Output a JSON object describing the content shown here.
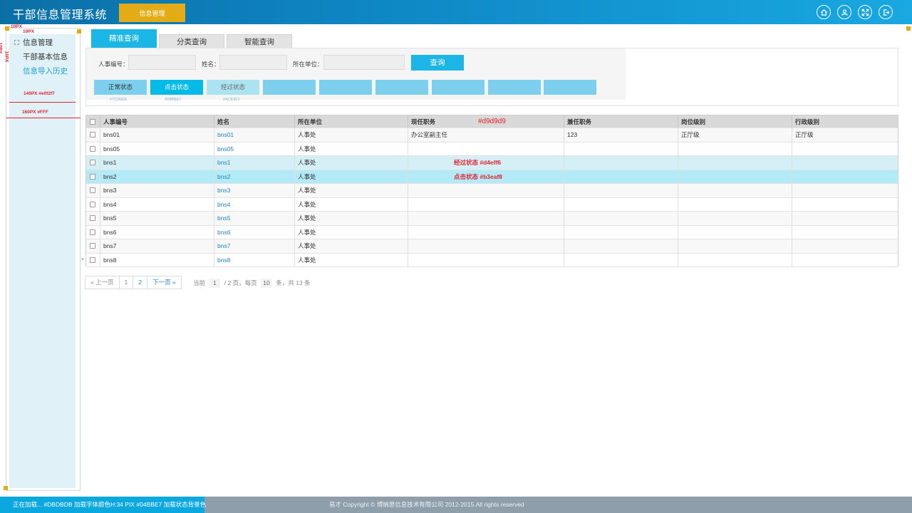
{
  "header": {
    "title": "干部信息管理系统",
    "nav_tab": "信息管理",
    "icons": [
      "home-icon",
      "user-icon",
      "fullscreen-icon",
      "logout-icon"
    ]
  },
  "sidebar": {
    "items": [
      {
        "label": "信息管理",
        "state": "active"
      },
      {
        "label": "干部基本信息",
        "state": "normal"
      },
      {
        "label": "信息导入历史",
        "state": "link"
      }
    ],
    "annotations": {
      "margin_top": "10PX",
      "margin_left": "10PX",
      "inner_size": "140PX  #e0f2f7",
      "outer_size": "160PX  #FFF"
    }
  },
  "tabs": [
    {
      "label": "精准查询",
      "active": true
    },
    {
      "label": "分类查询",
      "active": false
    },
    {
      "label": "智能查询",
      "active": false
    }
  ],
  "search": {
    "field_personnel_no": "人事编号：",
    "field_name": "姓名：",
    "field_unit": "所在单位：",
    "query_button": "查询"
  },
  "state_buttons": [
    {
      "label": "正常状态",
      "caption": "#7CD0EE",
      "color": "#7cd0ee"
    },
    {
      "label": "点击状态",
      "caption": "#04BBE7",
      "color": "#04bbe7"
    },
    {
      "label": "经过状态",
      "caption": "#ACE3F1",
      "color": "#ace3f1"
    },
    {
      "label": "",
      "caption": "",
      "color": "#7cd0ee"
    },
    {
      "label": "",
      "caption": "",
      "color": "#7cd0ee"
    },
    {
      "label": "",
      "caption": "",
      "color": "#7cd0ee"
    },
    {
      "label": "",
      "caption": "",
      "color": "#7cd0ee"
    },
    {
      "label": "",
      "caption": "",
      "color": "#7cd0ee"
    },
    {
      "label": "",
      "caption": "",
      "color": "#7cd0ee"
    }
  ],
  "table": {
    "header_annotation": "#d9d9d9",
    "columns": [
      "人事编号",
      "姓名",
      "所在单位",
      "现任职务",
      "兼任职务",
      "岗位级别",
      "行政级别"
    ],
    "rows": [
      {
        "id": "bns01",
        "name": "bns01",
        "unit": "人事处",
        "duty": "办公室副主任",
        "part_time": "123",
        "post_level": "正厅级",
        "admin_level": "正厅级",
        "state": "normal",
        "note": ""
      },
      {
        "id": "bns05",
        "name": "bns05",
        "unit": "人事处",
        "duty": "",
        "part_time": "",
        "post_level": "",
        "admin_level": "",
        "state": "normal",
        "note": ""
      },
      {
        "id": "bns1",
        "name": "bns1",
        "unit": "人事处",
        "duty": "",
        "part_time": "",
        "post_level": "",
        "admin_level": "",
        "state": "hover",
        "note": "经过状态  #d4eff6"
      },
      {
        "id": "bns2",
        "name": "bns2",
        "unit": "人事处",
        "duty": "",
        "part_time": "",
        "post_level": "",
        "admin_level": "",
        "state": "click",
        "note": "点击状态  #b3eaf8"
      },
      {
        "id": "bns3",
        "name": "bns3",
        "unit": "人事处",
        "duty": "",
        "part_time": "",
        "post_level": "",
        "admin_level": "",
        "state": "normal",
        "note": ""
      },
      {
        "id": "bns4",
        "name": "bns4",
        "unit": "人事处",
        "duty": "",
        "part_time": "",
        "post_level": "",
        "admin_level": "",
        "state": "normal",
        "note": ""
      },
      {
        "id": "bns5",
        "name": "bns5",
        "unit": "人事处",
        "duty": "",
        "part_time": "",
        "post_level": "",
        "admin_level": "",
        "state": "normal",
        "note": ""
      },
      {
        "id": "bns6",
        "name": "bns6",
        "unit": "人事处",
        "duty": "",
        "part_time": "",
        "post_level": "",
        "admin_level": "",
        "state": "normal",
        "note": ""
      },
      {
        "id": "bns7",
        "name": "bns7",
        "unit": "人事处",
        "duty": "",
        "part_time": "",
        "post_level": "",
        "admin_level": "",
        "state": "normal",
        "note": ""
      },
      {
        "id": "bns8",
        "name": "bns8",
        "unit": "人事处",
        "duty": "",
        "part_time": "",
        "post_level": "",
        "admin_level": "",
        "state": "normal",
        "note": ""
      }
    ],
    "row_colors": {
      "normal": "#ffffff",
      "alt": "#f8f8f8",
      "hover": "#d4eff6",
      "click": "#b3eaf8"
    }
  },
  "pagination": {
    "prev": "« 上一页",
    "pages": [
      "1",
      "2"
    ],
    "next": "下一页 »",
    "current_label": "当前",
    "current_page": "1",
    "total_pages": "/ 2 页，每页",
    "per_page": "10",
    "total": "条，共 13 条"
  },
  "footer": {
    "left_text": "正在加载...  #DBDBDB  加载字体颜色H:34 PIX #04BBE7  加载状态背景色",
    "copyright": "易才 Copyright © 博纳思信息技术有限公司 2012-2015.All rights reserved"
  }
}
